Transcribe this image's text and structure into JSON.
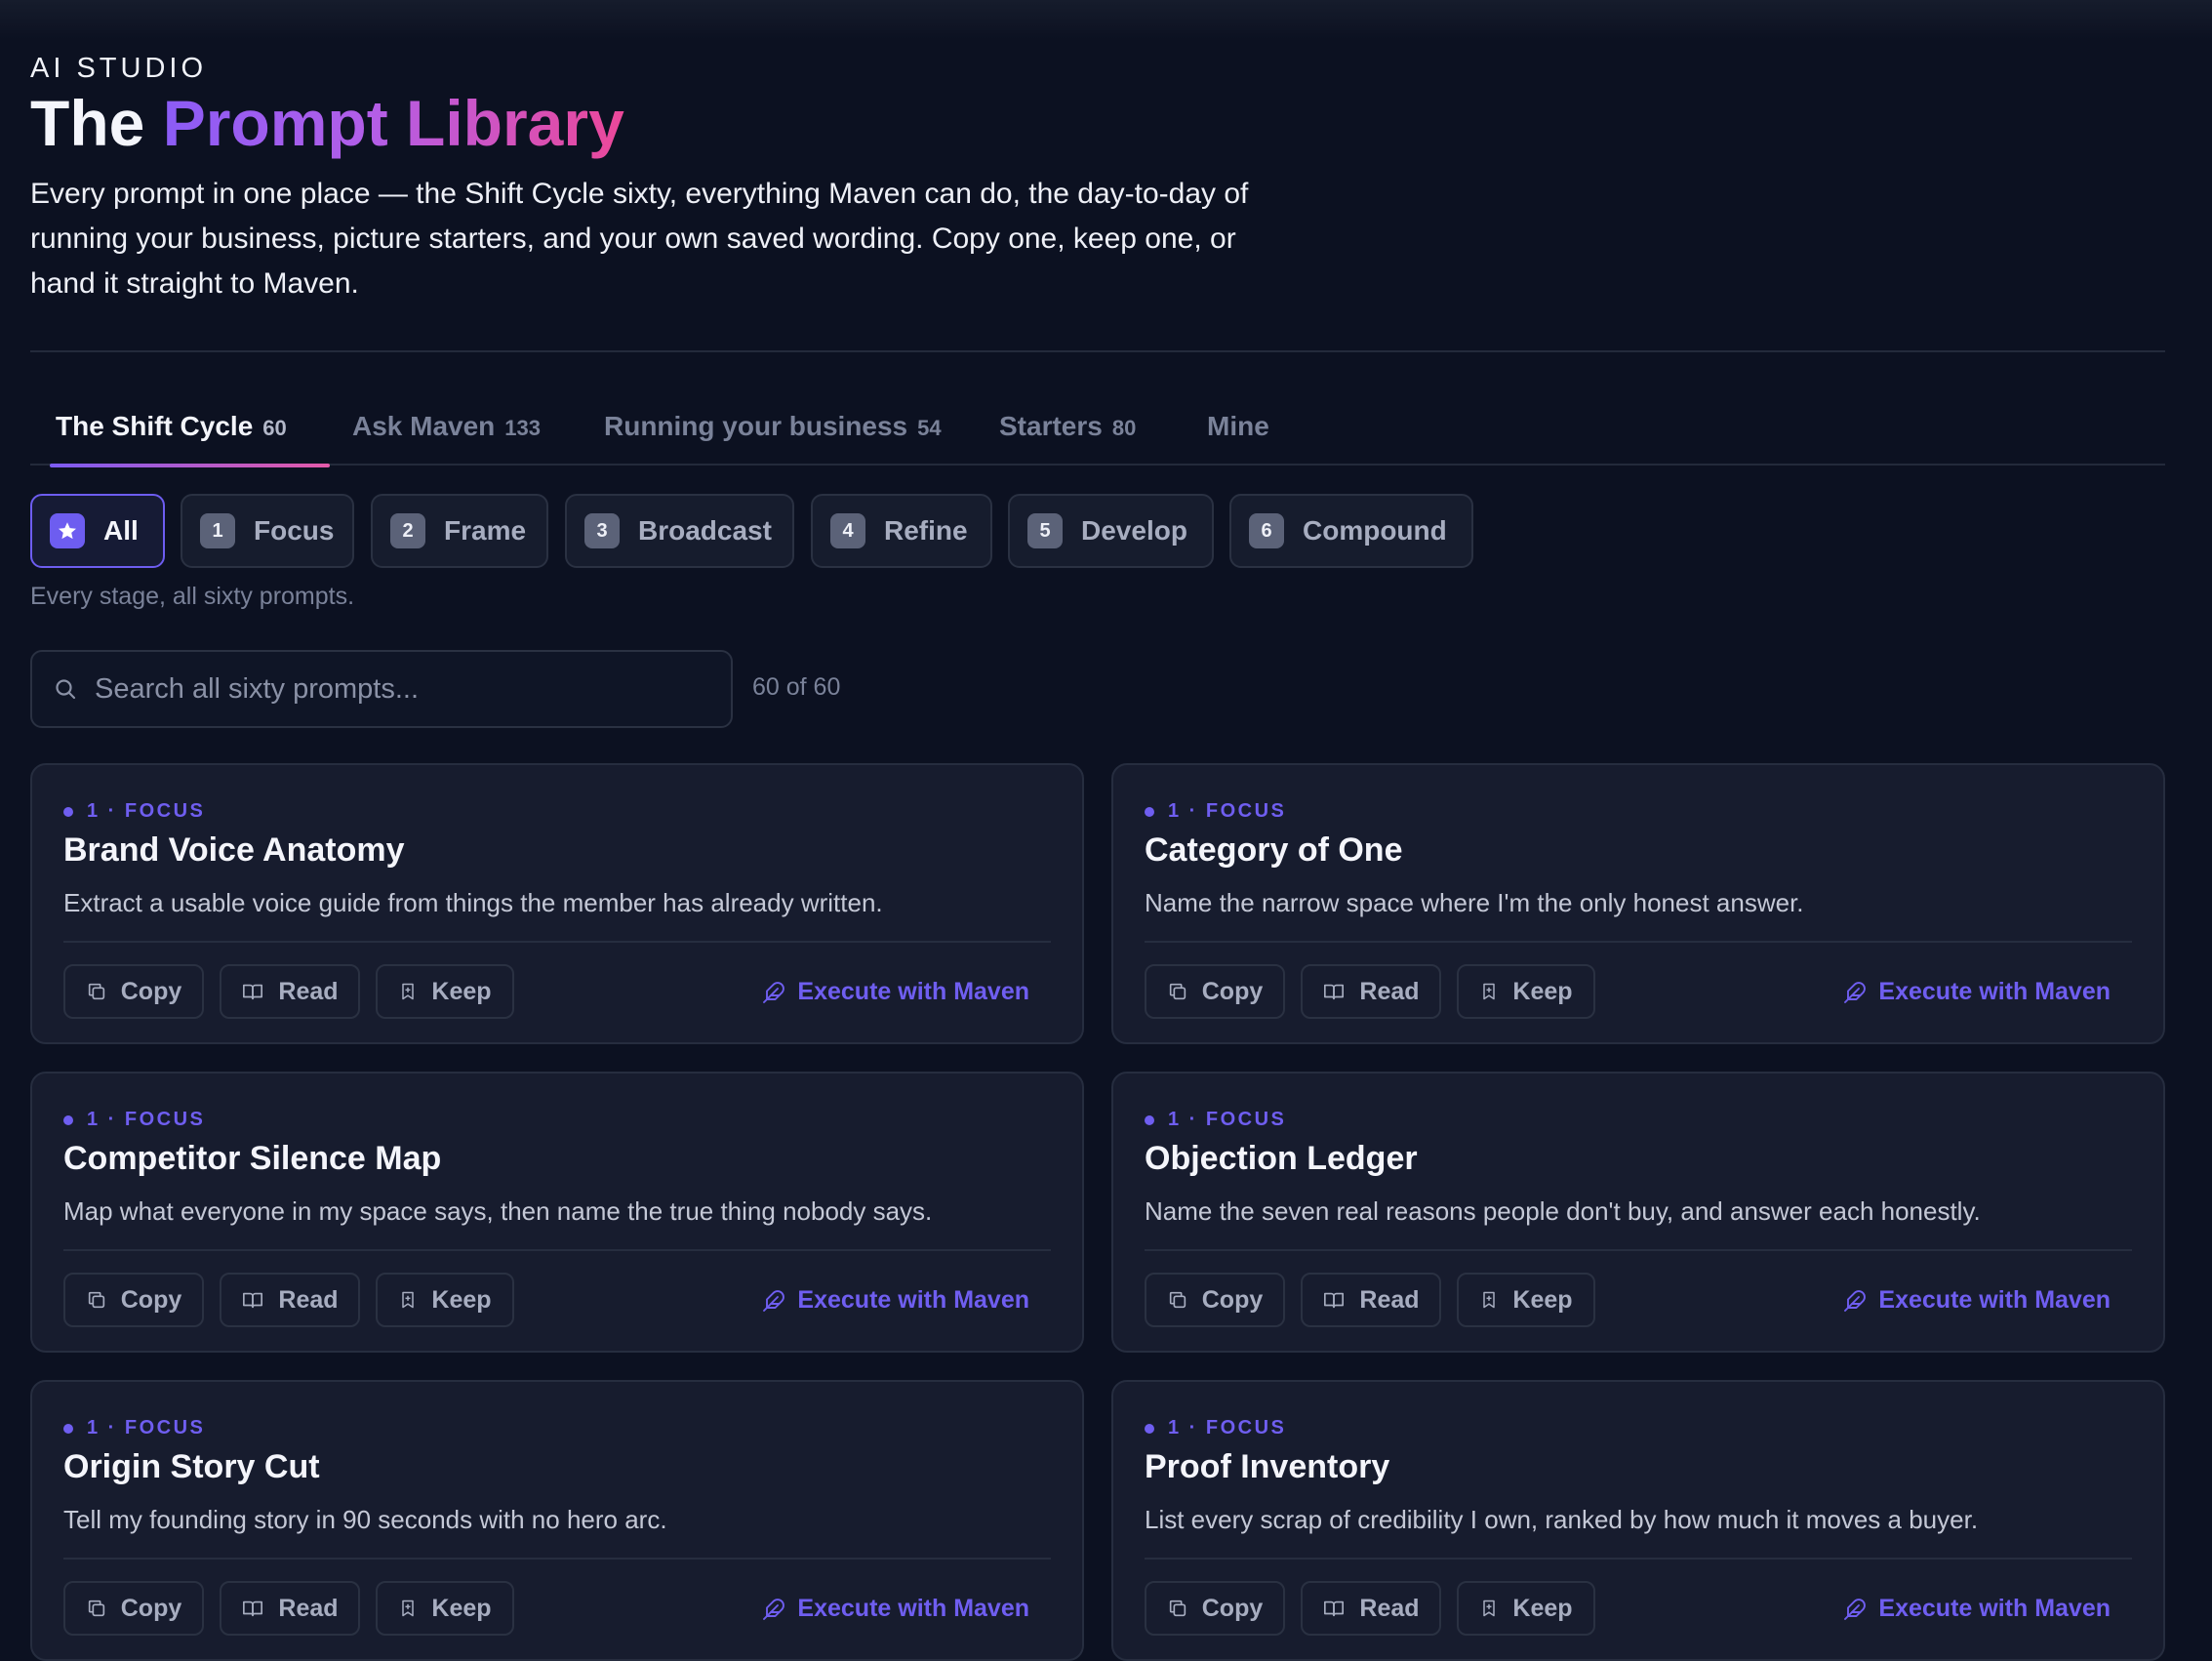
{
  "header": {
    "eyebrow": "AI STUDIO",
    "title_plain": "The",
    "title_accent": "Prompt Library",
    "intro": "Every prompt in one place — the Shift Cycle sixty, everything Maven can do, the day-to-day of running your business, picture starters, and your own saved wording. Copy one, keep one, or hand it straight to Maven."
  },
  "tabs": [
    {
      "label": "The Shift Cycle",
      "count": "60",
      "active": true
    },
    {
      "label": "Ask Maven",
      "count": "133"
    },
    {
      "label": "Running your business",
      "count": "54"
    },
    {
      "label": "Starters",
      "count": "80"
    },
    {
      "label": "Mine",
      "count": ""
    }
  ],
  "chips": [
    {
      "num": "★",
      "label": "All",
      "active": true
    },
    {
      "num": "1",
      "label": "Focus"
    },
    {
      "num": "2",
      "label": "Frame"
    },
    {
      "num": "3",
      "label": "Broadcast"
    },
    {
      "num": "4",
      "label": "Refine"
    },
    {
      "num": "5",
      "label": "Develop"
    },
    {
      "num": "6",
      "label": "Compound"
    }
  ],
  "stage_description": "Every stage, all sixty prompts.",
  "search": {
    "placeholder": "Search all sixty prompts...",
    "value": "",
    "result_count": "60 of 60"
  },
  "actions": {
    "copy": "Copy",
    "read": "Read",
    "keep": "Keep",
    "execute": "Execute with Maven"
  },
  "cards": [
    {
      "stage": "1 · FOCUS",
      "title": "Brand Voice Anatomy",
      "description": "Extract a usable voice guide from things the member has already written."
    },
    {
      "stage": "1 · FOCUS",
      "title": "Category of One",
      "description": "Name the narrow space where I'm the only honest answer."
    },
    {
      "stage": "1 · FOCUS",
      "title": "Competitor Silence Map",
      "description": "Map what everyone in my space says, then name the true thing nobody says."
    },
    {
      "stage": "1 · FOCUS",
      "title": "Objection Ledger",
      "description": "Name the seven real reasons people don't buy, and answer each honestly."
    },
    {
      "stage": "1 · FOCUS",
      "title": "Origin Story Cut",
      "description": "Tell my founding story in 90 seconds with no hero arc."
    },
    {
      "stage": "1 · FOCUS",
      "title": "Proof Inventory",
      "description": "List every scrap of credibility I own, ranked by how much it moves a buyer."
    }
  ],
  "colors": {
    "background": "#0c1121",
    "card": "#171c2e",
    "accent": "#6f5ef0",
    "gradient_start": "#8b5cf6",
    "gradient_end": "#ec4899"
  },
  "icons": {
    "search": "search-icon",
    "copy": "copy-icon",
    "read": "book-icon",
    "keep": "bookmark-icon",
    "execute": "feather-icon",
    "all": "star-icon"
  }
}
